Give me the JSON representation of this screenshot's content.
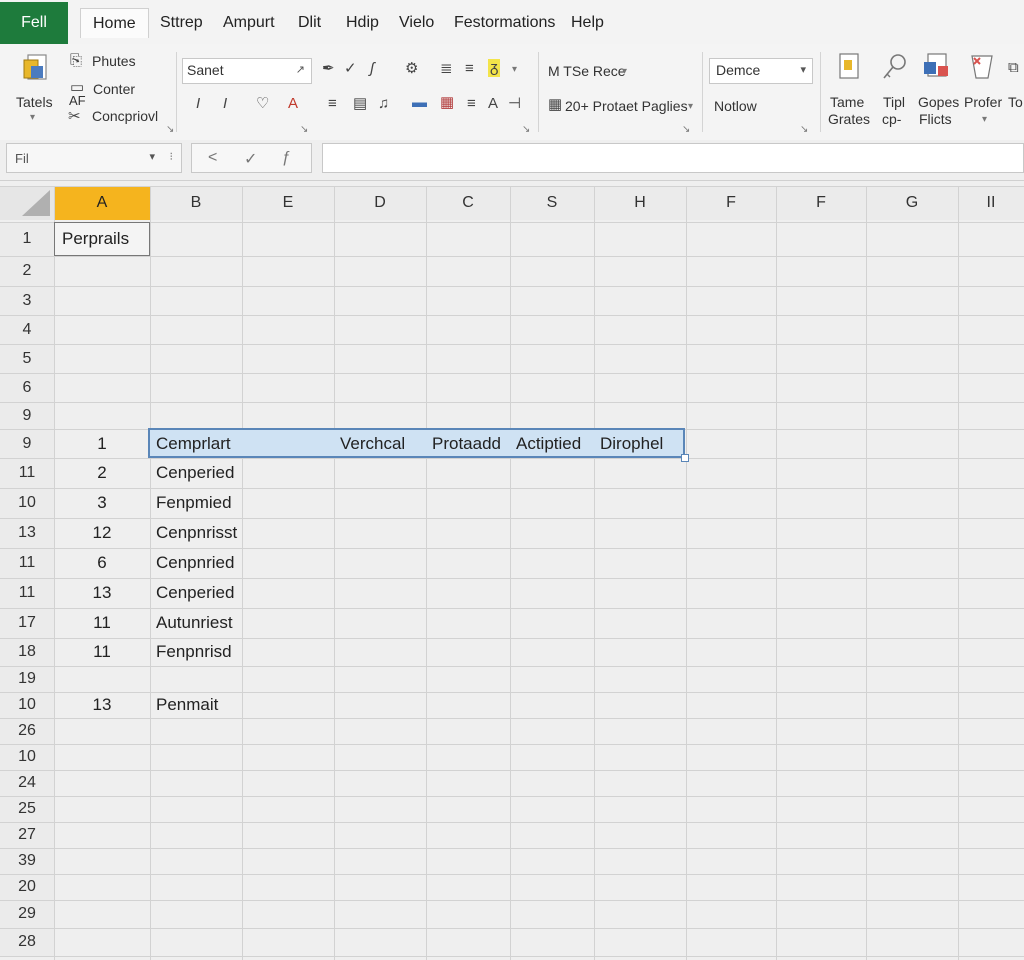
{
  "menu": {
    "file": "Fell",
    "items": [
      "Home",
      "Sttrep",
      "Ampurt",
      "Dlit",
      "Hdip",
      "Vielo",
      "Festormations",
      "Help"
    ]
  },
  "ribbon": {
    "tables_label": "Tatels",
    "clipboard": [
      "Phutes",
      "Conter",
      "Concpriovl"
    ],
    "af_label": "AF",
    "font_name": "Sanet",
    "format_label": "M TSe Rece",
    "pages_label": "20+ Protaet Paglies",
    "style_box": "Demce",
    "style_label": "Notlow",
    "right_groups": [
      {
        "line1": "Tame",
        "line2": "Grates"
      },
      {
        "line1": "Tipl",
        "line2": "cp-"
      },
      {
        "line1": "Gopes",
        "line2": "Flicts"
      },
      {
        "line1": "Profer",
        "line2": ""
      },
      {
        "line1": "To",
        "line2": ""
      }
    ]
  },
  "formula_bar": {
    "name_box": "Fil",
    "formula": ""
  },
  "sheet": {
    "columns": [
      "A",
      "B",
      "E",
      "D",
      "C",
      "S",
      "H",
      "F",
      "F",
      "G",
      "II"
    ],
    "selected_column": "A",
    "row_numbers": [
      "1",
      "2",
      "3",
      "4",
      "5",
      "6",
      "9",
      "9",
      "11",
      "10",
      "13",
      "11",
      "11",
      "17",
      "18",
      "19",
      "10",
      "26",
      "10",
      "24",
      "25",
      "27",
      "39",
      "20",
      "29",
      "28"
    ],
    "a1_text": "Perprails",
    "header_row": [
      "Cemprlart",
      "Verchcal",
      "Protaadd",
      "Actiptied",
      "Dirophel"
    ],
    "data_rows": [
      {
        "a": "1",
        "b": ""
      },
      {
        "a": "2",
        "b": "Cenperied"
      },
      {
        "a": "3",
        "b": "Fenpmied"
      },
      {
        "a": "12",
        "b": "Cenpnrisst"
      },
      {
        "a": "6",
        "b": "Cenpnried"
      },
      {
        "a": "13",
        "b": "Cenperied"
      },
      {
        "a": "11",
        "b": "Autunriest"
      },
      {
        "a": "11",
        "b": "Fenpnrisd"
      },
      {
        "a": "",
        "b": ""
      },
      {
        "a": "13",
        "b": "Penmait"
      }
    ]
  },
  "colors": {
    "file_tab": "#1e7b3c",
    "selected_column_header": "#f5b41e",
    "selection_fill": "#cfe2f3",
    "selection_border": "#5a86b8"
  }
}
